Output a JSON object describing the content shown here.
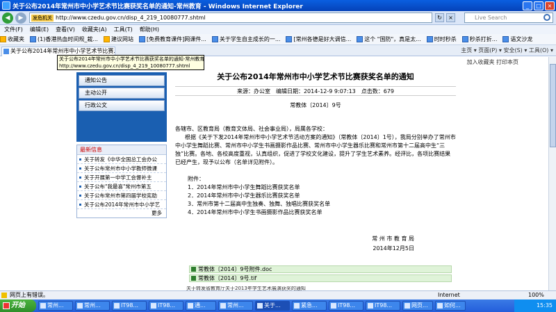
{
  "window": {
    "title": "关于公布2014年常州市中小学艺术节比赛获奖名单的通知-常州教育 - Windows Internet Explorer"
  },
  "address": {
    "security_label": "发危机关",
    "url": "http://www.czedu.gov.cn/disp_4_219_10080777.shtml",
    "search_placeholder": "Live Search"
  },
  "menu": [
    "文件(F)",
    "编辑(E)",
    "查看(V)",
    "收藏夹(A)",
    "工具(T)",
    "帮助(H)"
  ],
  "favorites": [
    "收藏夹",
    "(1)香港热血时间规_栽...",
    "建议网站",
    "[免费教育课件]网课件...",
    "关于学生自主成长的一...",
    "[常州各德是好大调信...",
    "这个 \"国防\"，真是太...",
    "时时秒杀",
    "秒杀打折...",
    "语文沙龙"
  ],
  "tab": {
    "label": "关于公布2014年常州市中小学艺术节比赛...",
    "tools": "主页 ▾   页面(P) ▾   安全(S) ▾   工具(O) ▾"
  },
  "tooltip": {
    "line1": "关于公布2014年常州市中小学艺术节比赛获奖名单的通知-常州教育",
    "line2": "http://www.czedu.gov.cn/disp_4_219_10080777.shtml"
  },
  "printbar": {
    "add_fav": "加入收藏夹",
    "print": "打印本页"
  },
  "sidebar": {
    "buttons": [
      "通知公告",
      "主动公开",
      "行政公文"
    ],
    "news_heading": "最新信息",
    "news": [
      "关于转发《中华全国总工会办公",
      "关于公布常州市中小学教师微课",
      "关于开展第一中学工会督补主",
      "关于公布\"我最喜\"常州市第五",
      "关于公布常州市第四届学校宪助",
      "关于公布2014年常州市中小学艺"
    ],
    "more": "更多"
  },
  "article": {
    "title": "关于公布2014年常州市中小学艺术节比赛获奖名单的通知",
    "meta": "来源：办公室　编辑日期：2014-12-9 9:07:13　点击数：679",
    "doc_no": "常教体〔2014〕9号",
    "addressee": "各辖市、区教育局（教育文体局、社会事业局），局属各学校：",
    "body": "根据《关于下发2014年常州市中小学艺术节活动方案的通知》（常教体〔2014〕1号），我局分别举办了常州市中小学生舞蹈比赛、常州市中小学生书画摄影作品比赛、常州市中小学生器乐比赛和常州市第十二届高中生“三独”比赛。各地、各校高度重视，认真组织，促进了学校文化建设，提升了学生艺术素养。经评比，各项比赛结果已经产生，现予以公布（名单详见附件）。",
    "attach_label": "附件：",
    "attachments": [
      "1．2014年常州市中小学生舞蹈比赛获奖名单",
      "2．2014年常州市中小学生器乐比赛获奖名单",
      "3．常州市第十二届高中生独奏、独舞、独唱比赛获奖名单",
      "4．2014年常州市中小学生书画摄影作品比赛获奖名单"
    ],
    "sign_org": "常 州 市 教 育 局",
    "sign_date": "2014年12月5日",
    "downloads": [
      "常教体〔2014〕9号附件.doc",
      "常教体〔2014〕9号.tif"
    ],
    "next_cutoff": "关于转发省教育厅关于2013年学生艺术展演获奖的通知"
  },
  "status": {
    "text": "网页上有错误。",
    "zone": "Internet",
    "zoom": "100%"
  },
  "taskbar": {
    "start": "开始",
    "items": [
      "常州...",
      "常州...",
      "IT98...",
      "IT98...",
      "通...",
      "常州...",
      "关于...",
      "紧急...",
      "IT98...",
      "IT98...",
      "网页...",
      "如何..."
    ],
    "clock": "15:35"
  }
}
